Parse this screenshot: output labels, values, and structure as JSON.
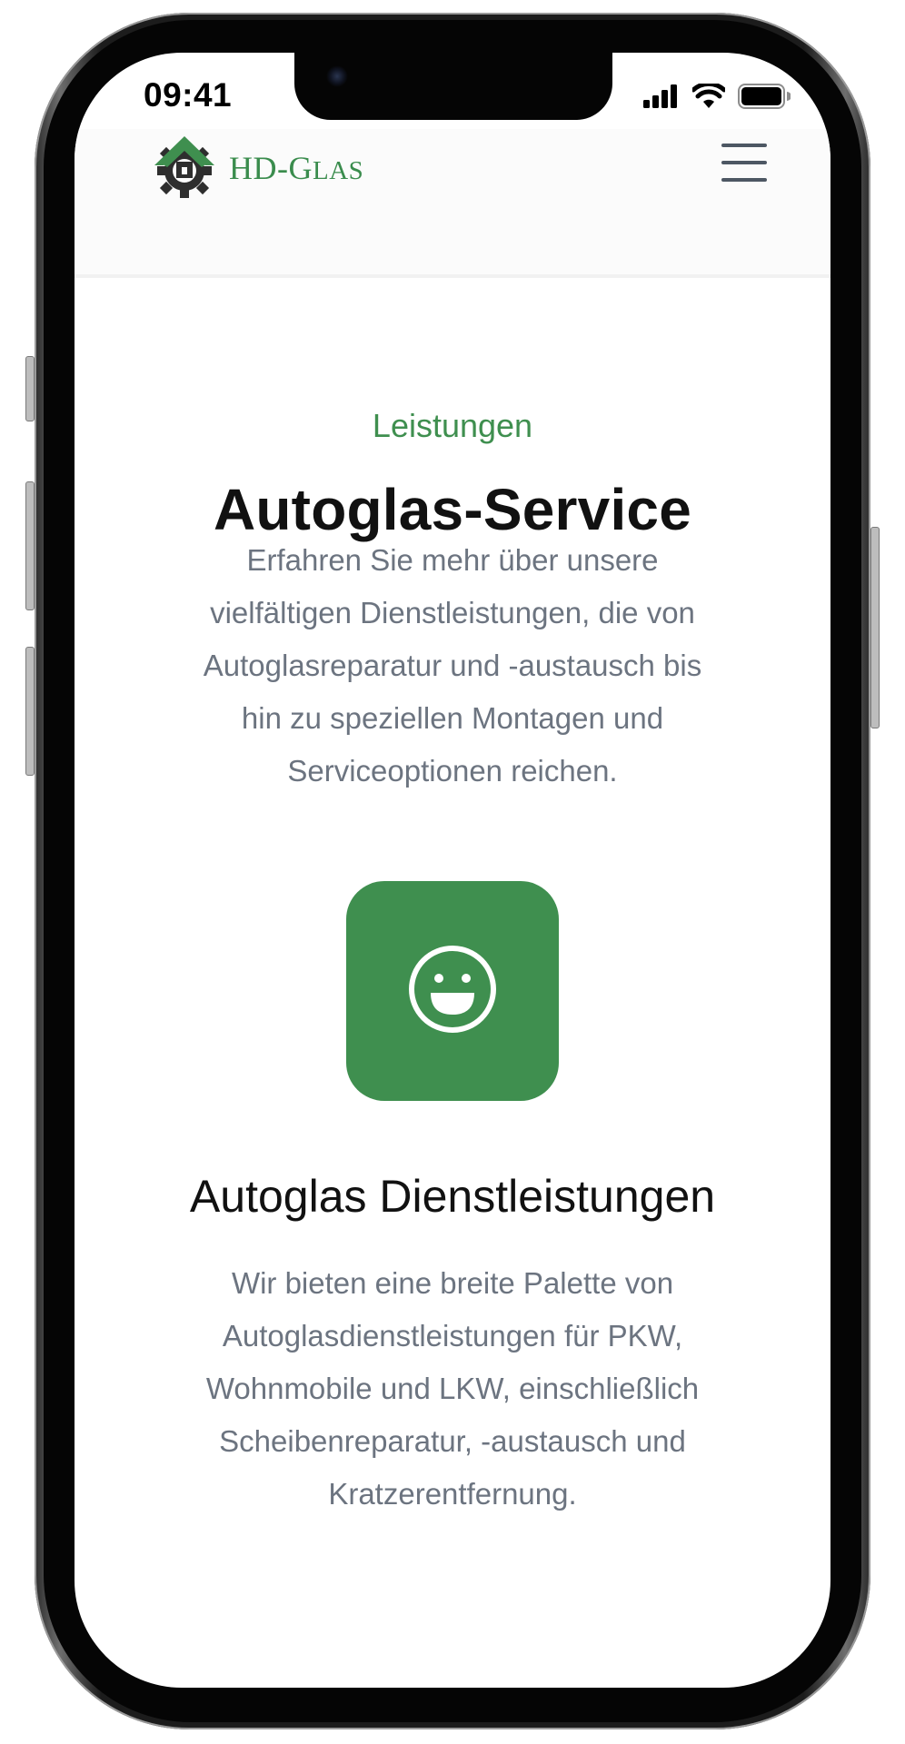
{
  "status_bar": {
    "time": "09:41",
    "icons": [
      "cellular-signal-icon",
      "wifi-icon",
      "battery-icon"
    ]
  },
  "header": {
    "logo_text_big": "HD-G",
    "logo_text_small": "LAS",
    "logo_icon": "gear-house-icon",
    "menu_icon": "hamburger-menu-icon"
  },
  "section": {
    "eyebrow": "Leistungen",
    "title": "Autoglas-Service",
    "intro": "Erfahren Sie mehr über unsere vielfältigen Dienstleistungen, die von Autoglasreparatur und -austausch bis hin zu speziellen Montagen und Serviceoptionen reichen."
  },
  "feature": {
    "icon": "smiley-face-icon",
    "title": "Autoglas Dienstleistungen",
    "text": "Wir bieten eine breite Palette von Autoglasdienstleistungen für PKW, Wohnmobile und LKW, einschließlich Scheibenreparatur, -austausch und Kratzerentfernung."
  },
  "colors": {
    "brand_green": "#3f8f4f",
    "body_text": "#6c7480",
    "heading": "#111111"
  }
}
